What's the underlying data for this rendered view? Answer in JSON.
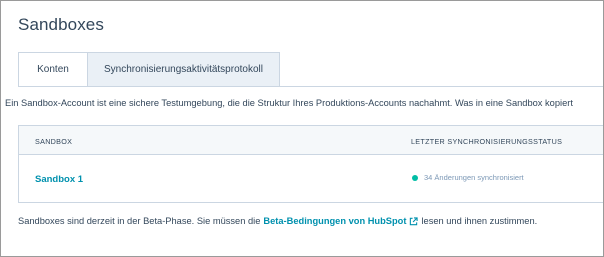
{
  "page": {
    "title": "Sandboxes"
  },
  "tabs": [
    {
      "label": "Konten",
      "active": true
    },
    {
      "label": "Synchronisierungsaktivitätsprotokoll",
      "active": false
    }
  ],
  "description": "Ein Sandbox-Account ist eine sichere Testumgebung, die die Struktur Ihres Produktions-Accounts nachahmt. Was in eine Sandbox kopiert",
  "table": {
    "columns": [
      "SANDBOX",
      "LETZTER SYNCHRONISIERUNGSSTATUS"
    ],
    "rows": [
      {
        "sandbox": "Sandbox 1",
        "status": "34 Änderungen synchronisiert"
      }
    ]
  },
  "footer": {
    "prefix": "Sandboxes sind derzeit in der Beta-Phase. Sie müssen die",
    "link": "Beta-Bedingungen von HubSpot",
    "suffix": "lesen und ihnen zustimmen."
  },
  "colors": {
    "link": "#0091ae",
    "status_ok": "#00bda5",
    "text": "#33475b",
    "border": "#cbd6e2"
  },
  "icons": {
    "status": "status-dot-icon",
    "external": "external-link-icon"
  }
}
